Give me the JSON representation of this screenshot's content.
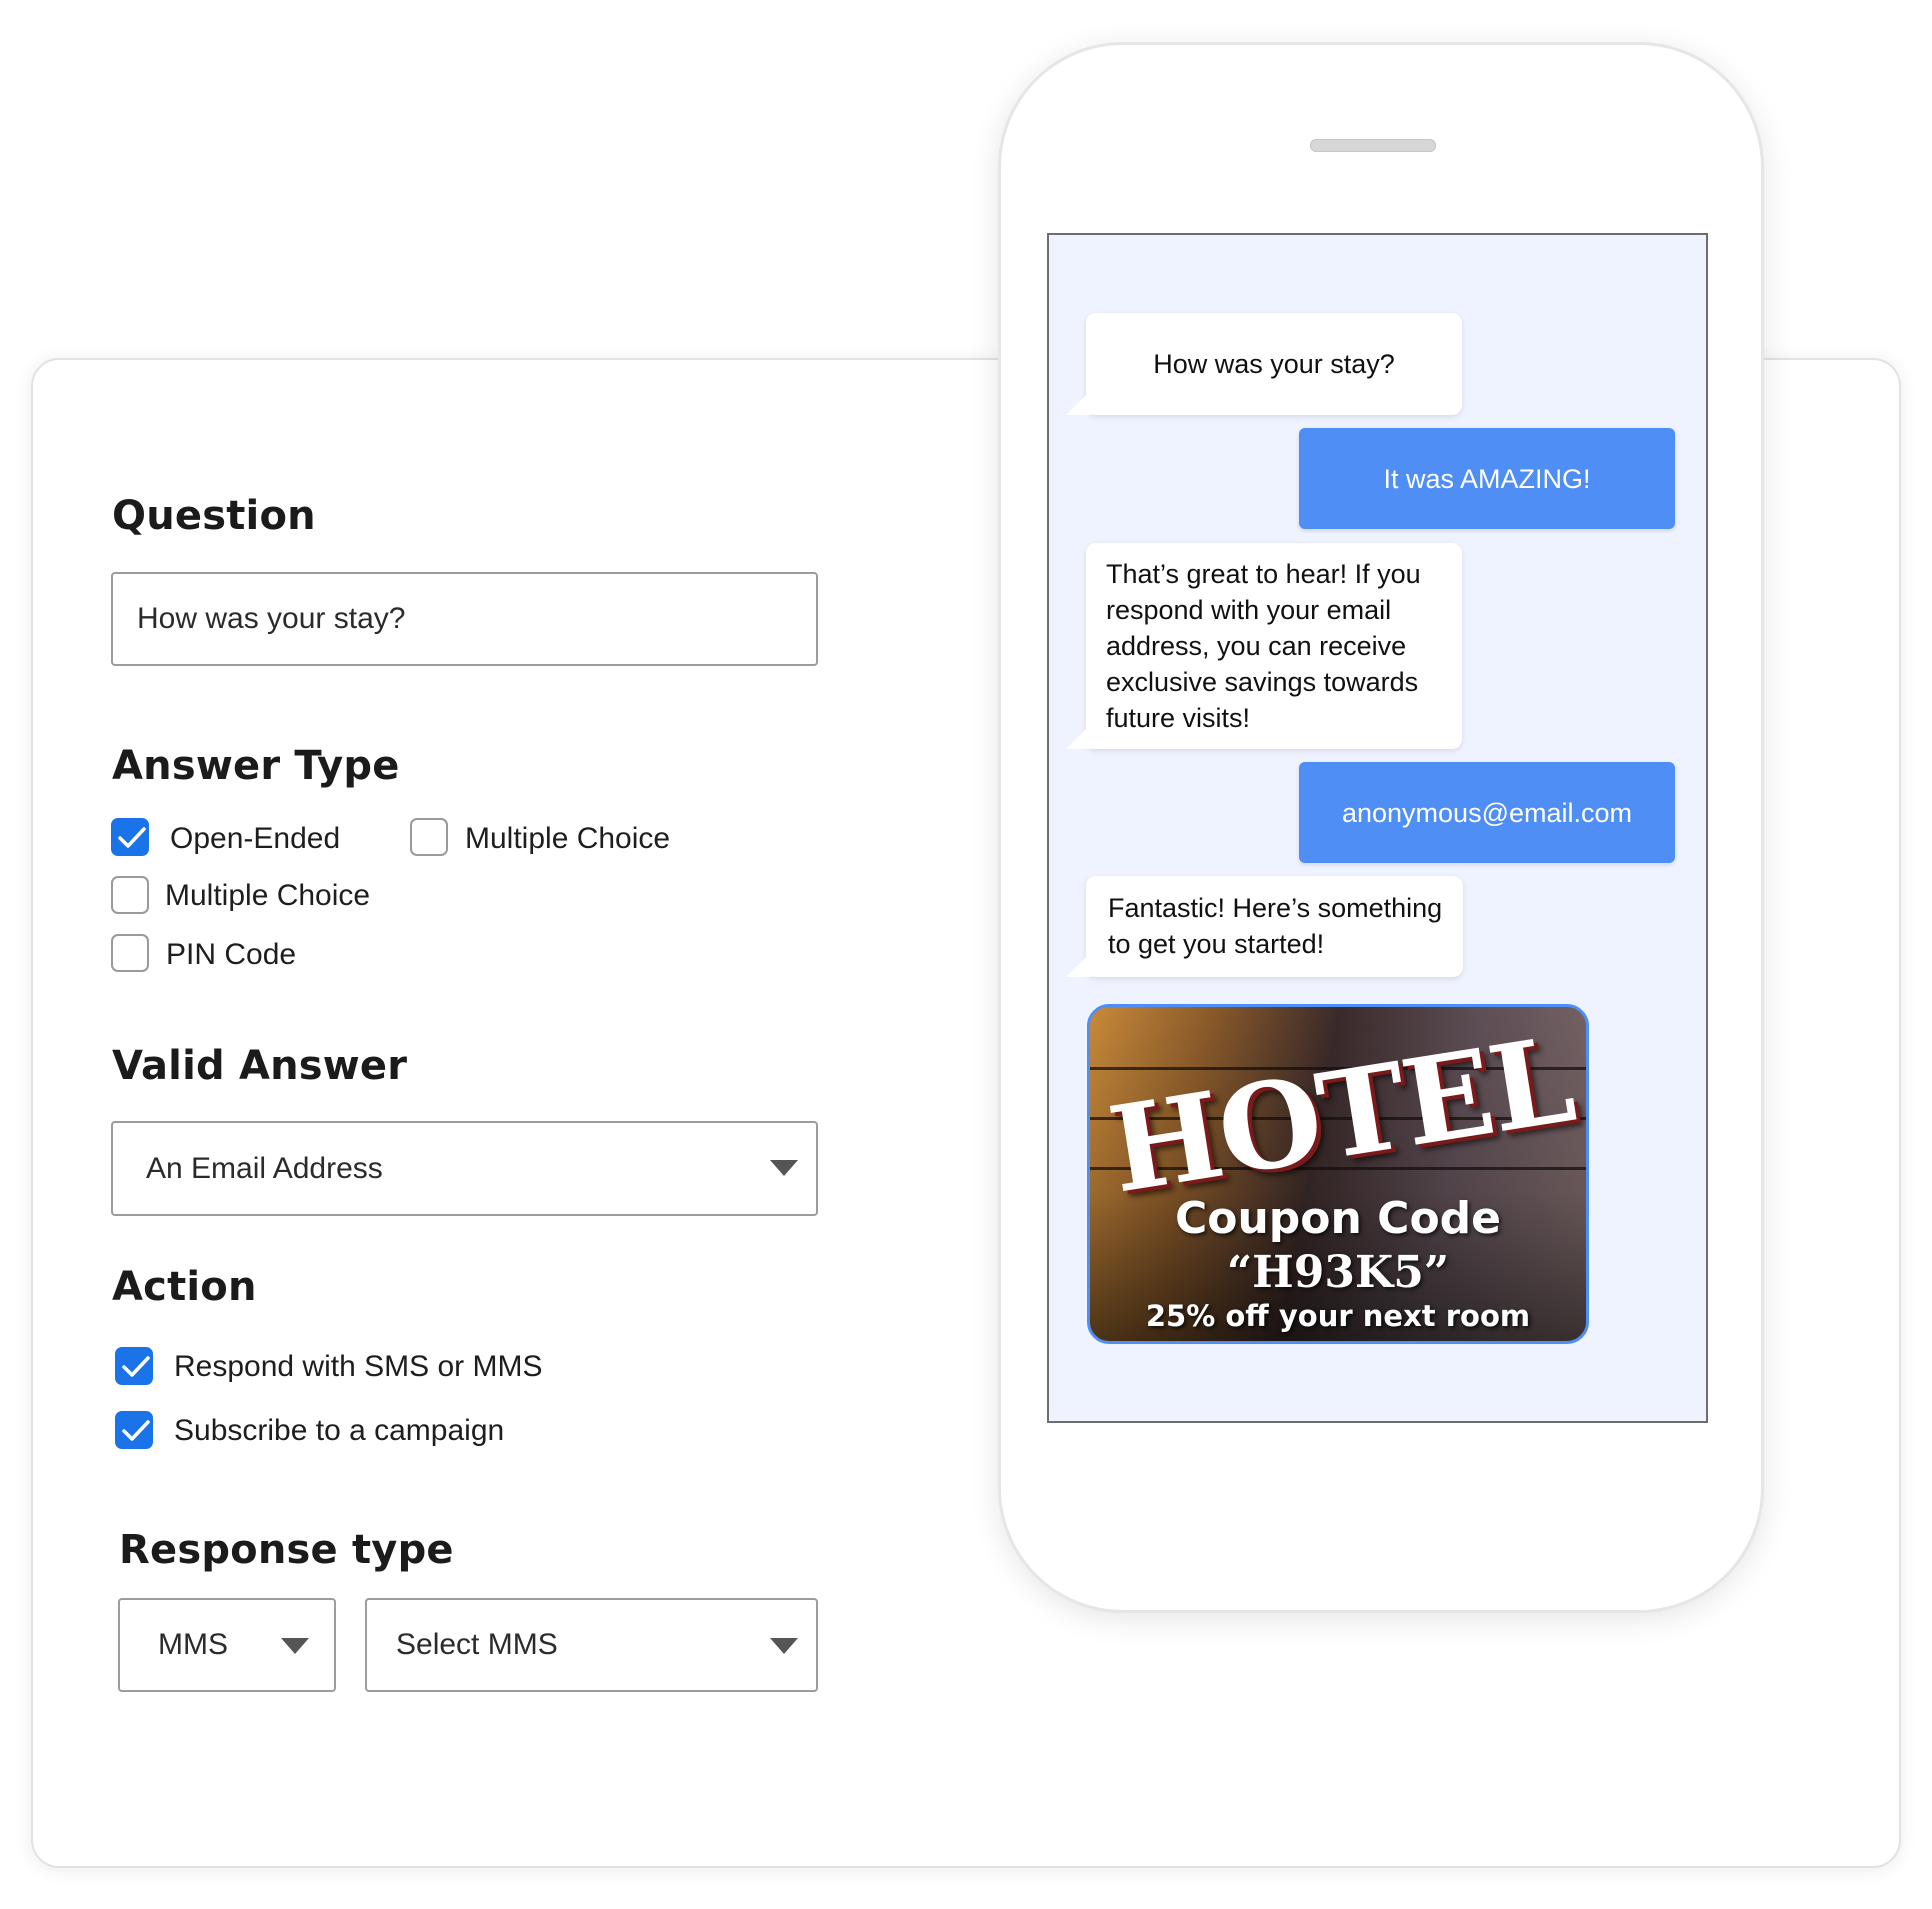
{
  "form": {
    "question_heading": "Question",
    "question_value": "How was your stay?",
    "answer_type_heading": "Answer Type",
    "answer_types": [
      {
        "label": "Open-Ended",
        "checked": true
      },
      {
        "label": "Multiple Choice",
        "checked": false
      },
      {
        "label": "Multiple Choice",
        "checked": false
      },
      {
        "label": "PIN Code",
        "checked": false
      }
    ],
    "valid_answer_heading": "Valid Answer",
    "valid_answer_value": "An Email Address",
    "action_heading": "Action",
    "actions": [
      {
        "label": "Respond with SMS or MMS",
        "checked": true
      },
      {
        "label": "Subscribe to a campaign",
        "checked": true
      }
    ],
    "response_type_heading": "Response type",
    "response_type_value": "MMS",
    "response_select_value": "Select MMS"
  },
  "chat": {
    "messages": [
      {
        "from": "bot",
        "text": "How was your stay?"
      },
      {
        "from": "user",
        "text": "It was AMAZING!"
      },
      {
        "from": "bot",
        "text": "That’s great to hear! If you respond with your email address, you can receive exclusive savings towards future visits!"
      },
      {
        "from": "user",
        "text": "anonymous@email.com"
      },
      {
        "from": "bot",
        "text": "Fantastic! Here’s something to get you started!"
      }
    ],
    "coupon": {
      "sign": "HOTEL",
      "title": "Coupon Code",
      "code": "“H93K5”",
      "offer": "25% off your next room"
    }
  },
  "colors": {
    "accent": "#1a73e8",
    "user_bubble": "#4f8ff5",
    "screen_bg": "#eef3ff"
  },
  "icons": [
    "checkmark-icon",
    "chevron-down-icon"
  ]
}
